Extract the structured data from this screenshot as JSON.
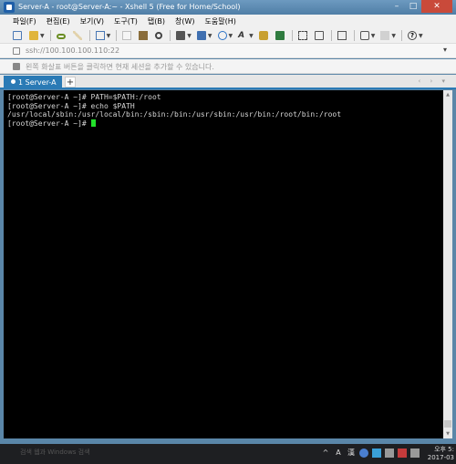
{
  "window": {
    "title": "Server-A - root@Server-A:~ - Xshell 5 (Free for Home/School)",
    "controls": {
      "minimize": "–",
      "maximize": "□",
      "close": "✕"
    }
  },
  "menu": [
    "파일(F)",
    "편집(E)",
    "보기(V)",
    "도구(T)",
    "탭(B)",
    "창(W)",
    "도움말(H)"
  ],
  "address": {
    "value": "ssh://100.100.100.110:22",
    "dropdown": "▾"
  },
  "hint": {
    "text": "왼쪽 화살표 버튼을 클릭하면 현재 세션을 추가할 수 있습니다."
  },
  "tabs": [
    {
      "label": "1 Server-A"
    }
  ],
  "tab_add": "+",
  "tab_nav": "‹ › ▾",
  "terminal": {
    "lines": [
      "[root@Server-A ~]# PATH=$PATH:/root",
      "[root@Server-A ~]# echo $PATH",
      "/usr/local/sbin:/usr/local/bin:/sbin:/bin:/usr/sbin:/usr/bin:/root/bin:/root"
    ],
    "prompt": "[root@Server-A ~]# "
  },
  "taskbar": {
    "left_text": "검색 웹과 Windows 검색",
    "tray": {
      "ime_a": "A",
      "ime_han": "漢"
    },
    "clock": {
      "time": "오후 5:",
      "date": "2017-03"
    }
  }
}
